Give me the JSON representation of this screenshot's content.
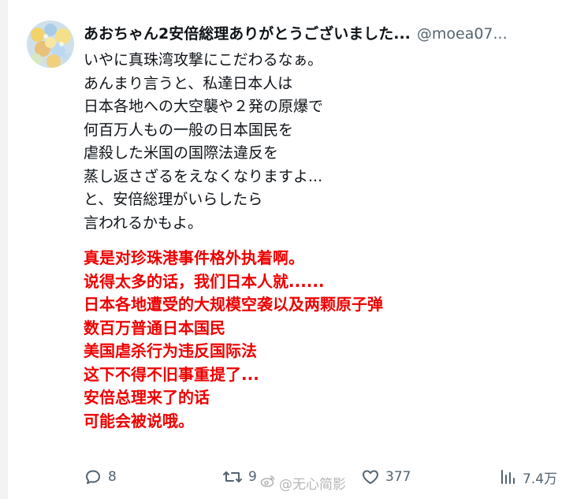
{
  "tweet": {
    "display_name": "あおちゃん2安倍総理ありがとうございました...",
    "handle": "@moea07...",
    "japanese_lines": [
      "いやに真珠湾攻撃にこだわるなぁ。",
      "あんまり言うと、私達日本人は",
      "日本各地への大空襲や２発の原爆で",
      "何百万人もの一般の日本国民を",
      "虐殺した米国の国際法違反を",
      "蒸し返さざるをえなくなりますよ...",
      "と、安倍総理がいらしたら",
      "言われるかもよ。"
    ],
    "translation_lines": [
      "真是对珍珠港事件格外执着啊。",
      "说得太多的话，我们日本人就......",
      "日本各地遭受的大规模空袭以及两颗原子弹",
      "数百万普通日本国民",
      "美国虐杀行为违反国际法",
      "这下不得不旧事重提了...",
      "安倍总理来了的话",
      "可能会被说哦。"
    ]
  },
  "actions": {
    "reply_count": "8",
    "retweet_count": "9",
    "like_count": "377",
    "views_count": "7.4万"
  },
  "watermark": {
    "text": "@无心简影"
  },
  "colors": {
    "text": "#0f1419",
    "secondary": "#536471",
    "translation": "#ee0000"
  },
  "icons": {
    "reply": "reply-icon",
    "retweet": "retweet-icon",
    "like": "heart-icon",
    "views": "views-icon",
    "watermark": "weibo-icon"
  }
}
